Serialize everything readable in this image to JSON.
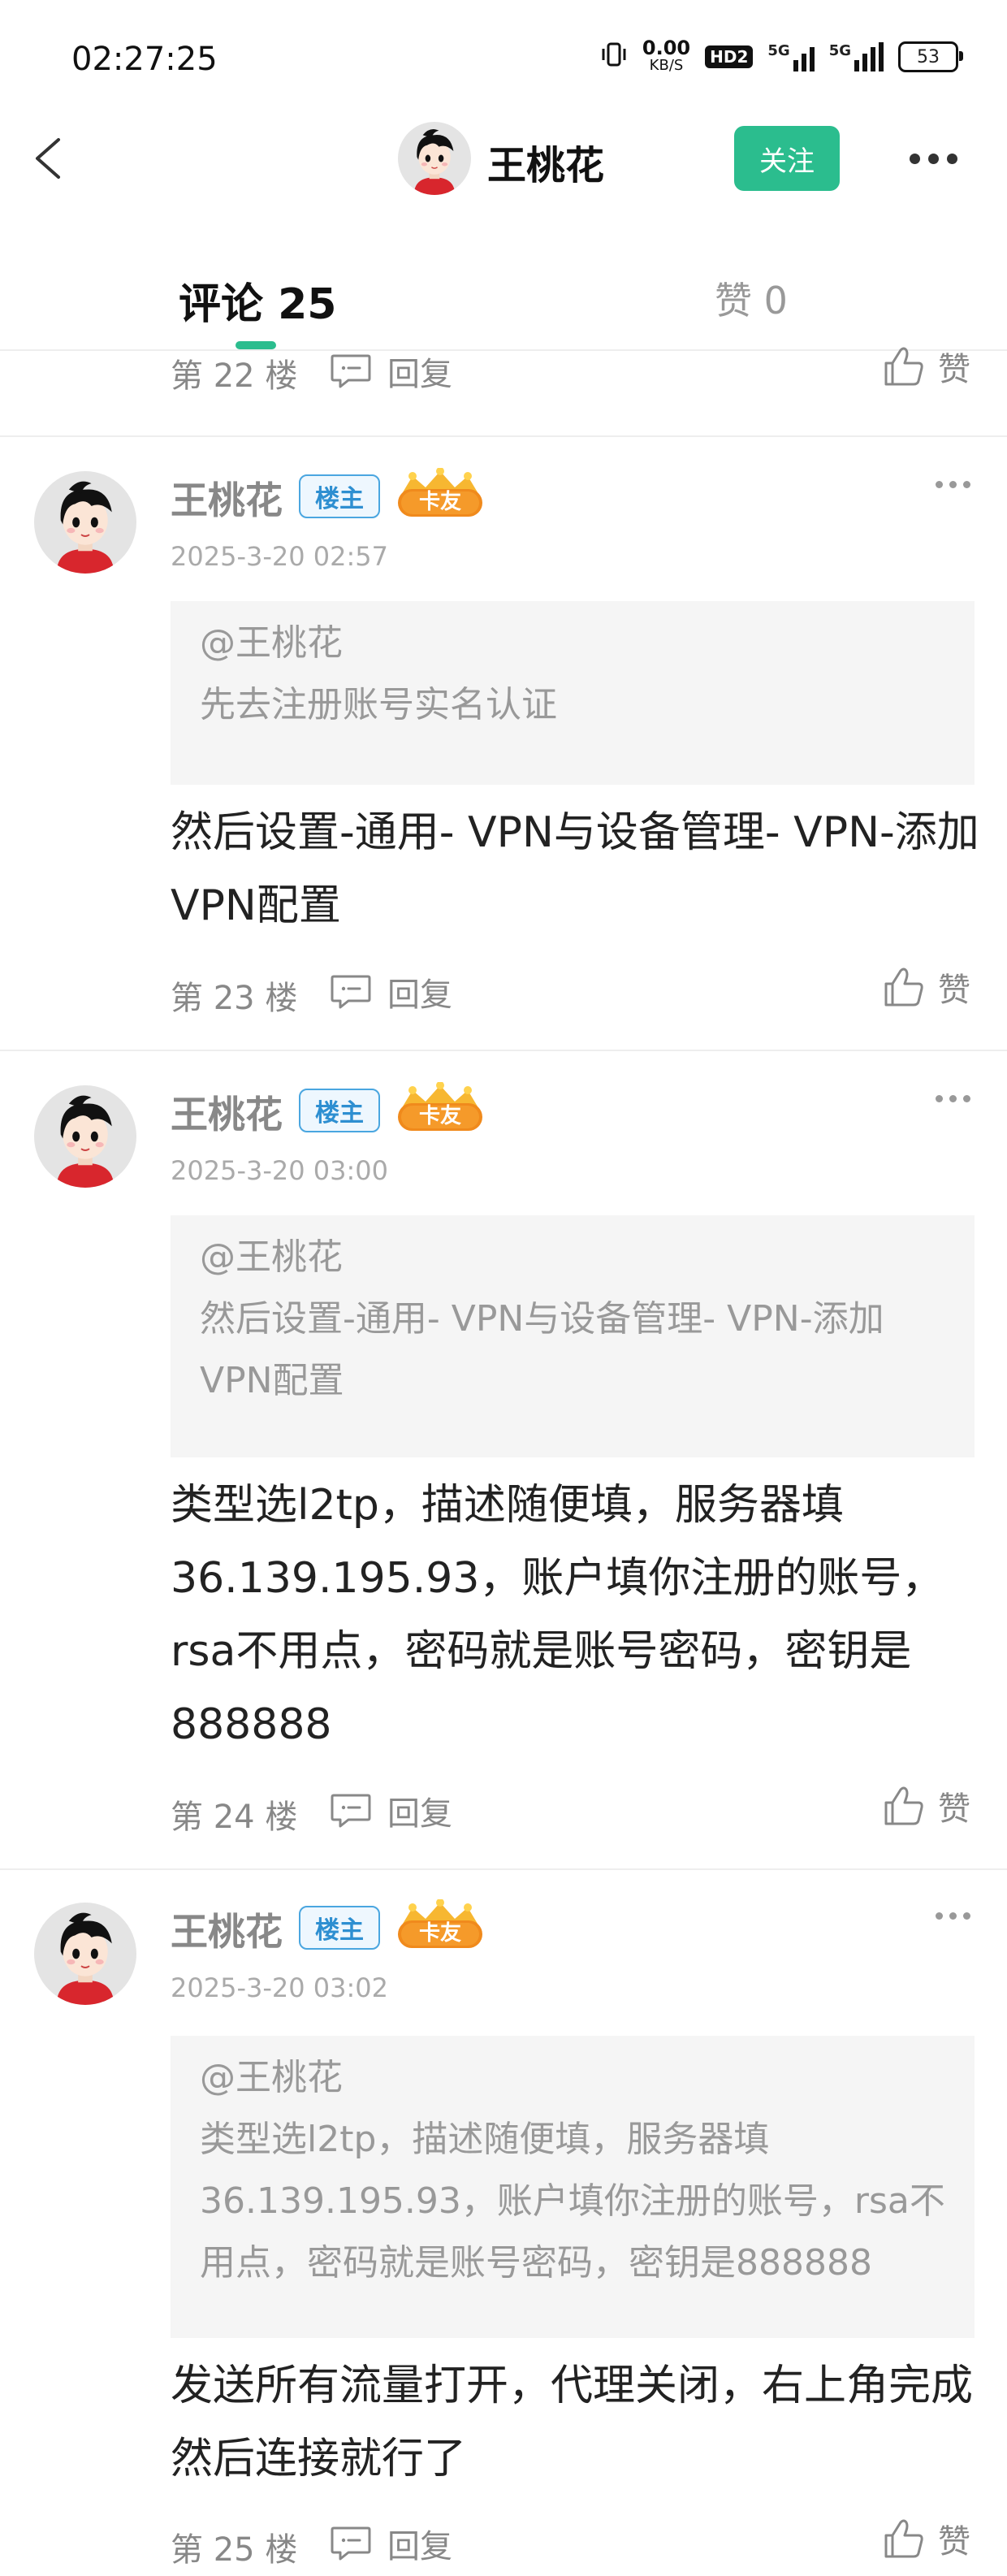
{
  "status_bar": {
    "time": "02:27:25",
    "net_speed_value": "0.00",
    "net_speed_unit": "KB/S",
    "hd_label": "HD2",
    "signal1_label": "5G",
    "signal2_label": "5G",
    "battery": "53"
  },
  "header": {
    "user_name": "王桃花",
    "follow_label": "关注"
  },
  "tabs": {
    "comments_label": "评论 25",
    "likes_label": "赞 0"
  },
  "common": {
    "reply_label": "回复",
    "like_label": "赞",
    "owner_badge": "楼主",
    "card_badge": "卡友"
  },
  "top_partial": {
    "floor": "第 22 楼"
  },
  "comments": [
    {
      "user": "王桃花",
      "time": "2025-3-20 02:57",
      "quote_user": "@王桃花",
      "quote_text": "先去注册账号实名认证",
      "text": "然后设置-通用- VPN与设备管理- VPN-添加VPN配置",
      "floor": "第 23 楼"
    },
    {
      "user": "王桃花",
      "time": "2025-3-20 03:00",
      "quote_user": "@王桃花",
      "quote_text": "然后设置-通用- VPN与设备管理- VPN-添加VPN配置",
      "text": "类型选l2tp，描述随便填，服务器填36.139.195.93，账户填你注册的账号，rsa不用点，密码就是账号密码，密钥是888888",
      "floor": "第 24 楼"
    },
    {
      "user": "王桃花",
      "time": "2025-3-20 03:02",
      "quote_user": "@王桃花",
      "quote_text": "类型选l2tp，描述随便填，服务器填36.139.195.93，账户填你注册的账号，rsa不用点，密码就是账号密码，密钥是888888",
      "text": "发送所有流量打开，代理关闭，右上角完成然后连接就行了",
      "floor": "第 25 楼"
    }
  ]
}
